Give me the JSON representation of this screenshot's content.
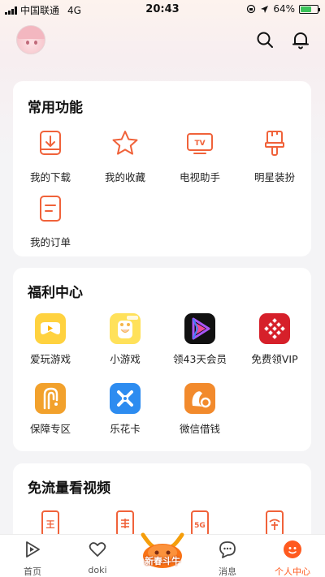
{
  "status_bar": {
    "carrier": "中国联通",
    "network": "4G",
    "time": "20:43",
    "battery": "64%",
    "battery_level": 0.64
  },
  "section_common": {
    "title": "常用功能",
    "items": [
      {
        "label": "我的下载",
        "icon": "download-icon"
      },
      {
        "label": "我的收藏",
        "icon": "star-icon"
      },
      {
        "label": "电视助手",
        "icon": "tv-icon"
      },
      {
        "label": "明星装扮",
        "icon": "brush-icon"
      },
      {
        "label": "我的订单",
        "icon": "order-icon"
      }
    ]
  },
  "section_welfare": {
    "title": "福利中心",
    "items": [
      {
        "label": "爱玩游戏",
        "icon": "game-controller-icon"
      },
      {
        "label": "小游戏",
        "icon": "mini-game-icon"
      },
      {
        "label": "领43天会员",
        "icon": "video-vip-icon"
      },
      {
        "label": "免费领VIP",
        "icon": "free-vip-icon"
      },
      {
        "label": "保障专区",
        "icon": "protection-icon"
      },
      {
        "label": "乐花卡",
        "icon": "lehua-card-icon"
      },
      {
        "label": "微信借钱",
        "icon": "wechat-loan-icon"
      }
    ]
  },
  "section_free_flow": {
    "title": "免流量看视频",
    "items": [
      {
        "icon": "wang-card-icon"
      },
      {
        "icon": "unicom-card-icon"
      },
      {
        "icon": "5g-card-icon"
      },
      {
        "icon": "telecom-card-icon"
      }
    ]
  },
  "tabbar": {
    "items": [
      {
        "label": "首页",
        "icon": "home-play-icon"
      },
      {
        "label": "doki",
        "icon": "doki-heart-icon"
      },
      {
        "label": "新春斗牛",
        "icon": "spring-festival-ox-icon"
      },
      {
        "label": "消息",
        "icon": "message-icon"
      },
      {
        "label": "个人中心",
        "icon": "profile-icon"
      }
    ],
    "active_index": 4,
    "accent_color": "#ff5a1f"
  },
  "colors": {
    "icon_orange": "#f0623a",
    "accent": "#ff5a1f"
  }
}
